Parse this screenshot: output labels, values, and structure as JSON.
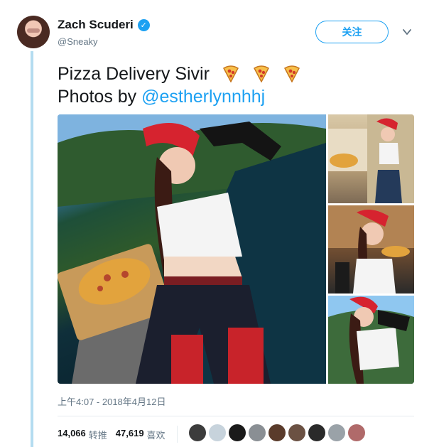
{
  "author": {
    "name": "Zach Scuderi",
    "handle": "@Sneaky",
    "verified_icon": "verified-badge-icon"
  },
  "follow_label": "关注",
  "menu_icon": "chevron-down-icon",
  "tweet": {
    "line1": "Pizza Delivery Sivir",
    "line2_prefix": "Photos by ",
    "mention": "@estherlynnhhj",
    "emojis": [
      "pizza-icon",
      "pizza-icon",
      "pizza-icon"
    ]
  },
  "timestamp": "上午4:07 - 2018年4月12日",
  "stats": {
    "retweets_count": "14,066",
    "retweets_label": "转推",
    "likes_count": "47,619",
    "likes_label": "喜欢"
  },
  "likers": [
    {
      "color": "#3c3c3c"
    },
    {
      "color": "#c7d3dc"
    },
    {
      "color": "#1a1a1a"
    },
    {
      "color": "#8a8f94"
    },
    {
      "color": "#5a3b2b"
    },
    {
      "color": "#6b5143"
    },
    {
      "color": "#2a2a2a"
    },
    {
      "color": "#9aa2a8"
    },
    {
      "color": "#b06a6a"
    }
  ],
  "colors": {
    "accent": "#1da1f2",
    "thread_line": "#b4dcf0",
    "muted_text": "#657786"
  }
}
